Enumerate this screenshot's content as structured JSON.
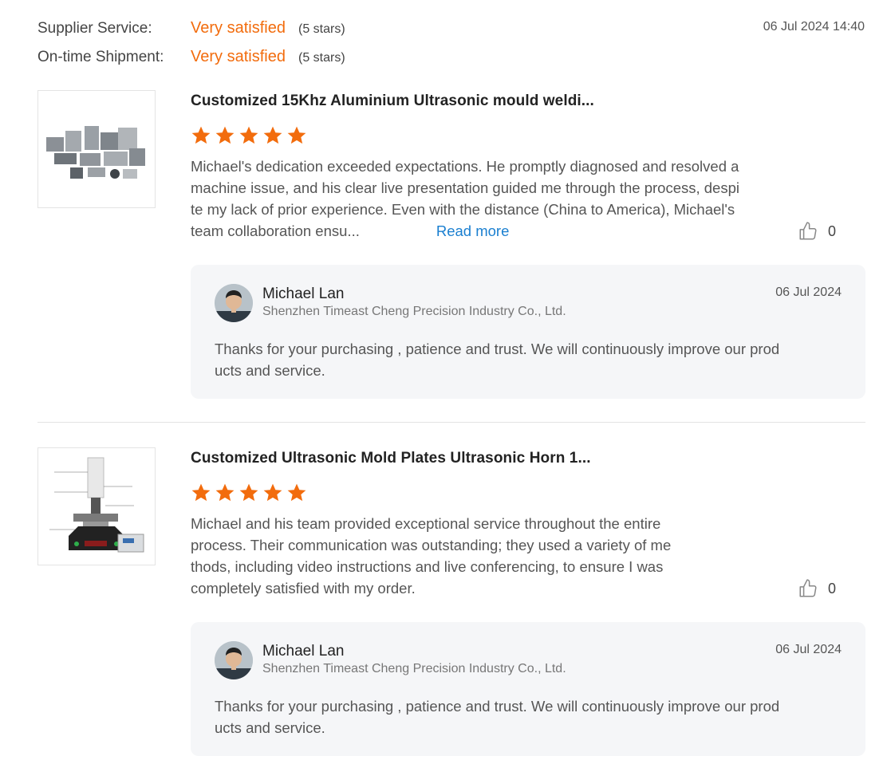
{
  "ratings": [
    {
      "label": "Supplier Service:",
      "value": "Very satisfied",
      "stars": "(5 stars)"
    },
    {
      "label": "On-time Shipment:",
      "value": "Very satisfied",
      "stars": "(5 stars)"
    }
  ],
  "review_date": "06 Jul 2024 14:40",
  "reviews": [
    {
      "product_title": "Customized 15Khz Aluminium Ultrasonic mould weldi...",
      "stars": 5,
      "text_lines": [
        "Michael's dedication exceeded expectations. He promptly diagnosed and resolved a",
        "machine issue, and his clear live presentation guided me through the process, despi",
        "te my lack of prior experience. Even with the distance (China to America), Michael's",
        "team collaboration ensu..."
      ],
      "read_more": "Read more",
      "likes": "0",
      "reply": {
        "name": "Michael Lan",
        "company": "Shenzhen Timeast Cheng Precision Industry Co., Ltd.",
        "date": "06 Jul 2024",
        "text_lines": [
          "Thanks for your purchasing , patience and trust. We will continuously improve our prod",
          "ucts and service."
        ]
      }
    },
    {
      "product_title": "Customized Ultrasonic Mold Plates Ultrasonic Horn 1...",
      "stars": 5,
      "text_lines": [
        "Michael and his team provided exceptional service throughout the entire",
        "process. Their communication was outstanding; they used a variety of me",
        "thods, including video instructions and live conferencing, to ensure I was",
        "completely satisfied with my order."
      ],
      "likes": "0",
      "reply": {
        "name": "Michael Lan",
        "company": "Shenzhen Timeast Cheng Precision Industry Co., Ltd.",
        "date": "06 Jul 2024",
        "text_lines": [
          "Thanks for your purchasing , patience and trust. We will continuously improve our prod",
          "ucts and service."
        ]
      }
    }
  ],
  "colors": {
    "accent": "#f26c0d",
    "link": "#1a7fd0",
    "reply_bg": "#f5f6f8"
  }
}
